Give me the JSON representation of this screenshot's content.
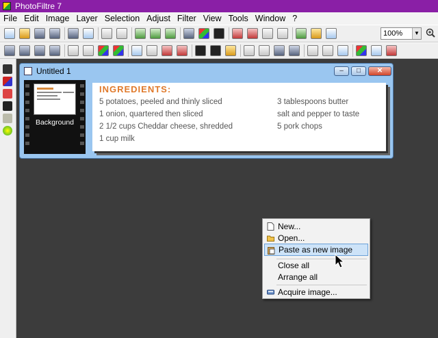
{
  "app": {
    "title": "PhotoFiltre 7"
  },
  "menu": [
    "File",
    "Edit",
    "Image",
    "Layer",
    "Selection",
    "Adjust",
    "Filter",
    "View",
    "Tools",
    "Window",
    "?"
  ],
  "zoom": {
    "value": "100%"
  },
  "document": {
    "title": "Untitled 1",
    "layer_label": "Background",
    "window_buttons": {
      "minimize": "–",
      "restore": "□",
      "close": "✕"
    }
  },
  "image": {
    "heading": "INGREDIENTS:",
    "left_column": [
      "5 potatoes, peeled and thinly sliced",
      "1 onion, quartered then sliced",
      "2 1/2 cups Cheddar cheese, shredded",
      "1 cup milk"
    ],
    "right_column": [
      "3 tablespoons butter",
      "salt and pepper to taste",
      "5 pork chops"
    ]
  },
  "context_menu": {
    "items": [
      {
        "label": "New...",
        "icon": "new-document-icon"
      },
      {
        "label": "Open...",
        "icon": "open-folder-icon"
      },
      {
        "label": "Paste as new image",
        "icon": "paste-icon",
        "highlighted": true
      },
      {
        "label": "Close all",
        "icon": ""
      },
      {
        "label": "Arrange all",
        "icon": ""
      },
      {
        "label": "Acquire image...",
        "icon": "scanner-icon"
      }
    ]
  },
  "colors": {
    "titlebar": "#8a1fa6",
    "workspace": "#3c3c3c",
    "heading": "#e0792a",
    "highlight": "#cde3f8"
  }
}
